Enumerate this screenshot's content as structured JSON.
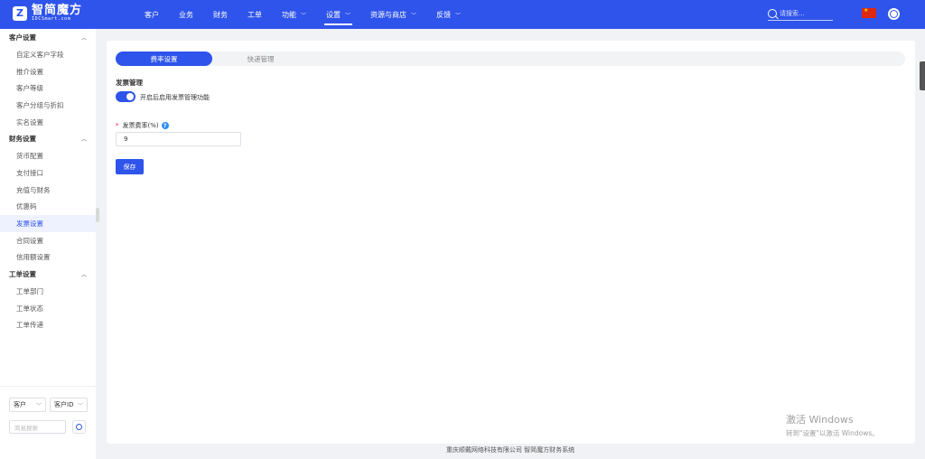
{
  "brand": {
    "name": "智简魔方",
    "sub": "IDCSmart.com"
  },
  "nav": [
    {
      "label": "客户",
      "dropdown": false,
      "active": false
    },
    {
      "label": "业务",
      "dropdown": false,
      "active": false
    },
    {
      "label": "财务",
      "dropdown": false,
      "active": false
    },
    {
      "label": "工单",
      "dropdown": false,
      "active": false
    },
    {
      "label": "功能",
      "dropdown": true,
      "active": false
    },
    {
      "label": "设置",
      "dropdown": true,
      "active": true
    },
    {
      "label": "资源与商店",
      "dropdown": true,
      "active": false
    },
    {
      "label": "反馈",
      "dropdown": true,
      "active": false
    }
  ],
  "search": {
    "placeholder": "请搜索..."
  },
  "sidebar": {
    "groups": [
      {
        "title": "客户设置",
        "items": [
          "自定义客户字段",
          "推介设置",
          "客户等级",
          "客户分组与折扣",
          "实名设置"
        ]
      },
      {
        "title": "财务设置",
        "items": [
          "货币配置",
          "支付接口",
          "充值与财务",
          "优惠码",
          "发票设置",
          "合同设置",
          "信用额设置"
        ]
      },
      {
        "title": "工单设置",
        "items": [
          "工单部门",
          "工单状态",
          "工单传递"
        ]
      }
    ],
    "active_item": "发票设置",
    "filter": {
      "type_value": "客户",
      "field_value": "客户ID",
      "search_placeholder": "简易搜索"
    }
  },
  "tabs": [
    {
      "label": "费率设置",
      "active": true
    },
    {
      "label": "快递管理",
      "active": false
    }
  ],
  "invoice": {
    "section_title": "发票管理",
    "switch_on": true,
    "switch_label": "开启后启用发票管理功能",
    "rate_label": "发票费率(%)",
    "rate_value": "9",
    "help_symbol": "?",
    "required_mark": "*",
    "save_label": "保存"
  },
  "watermark": {
    "title": "激活 Windows",
    "subtitle": "转到\"设置\"以激活 Windows。"
  },
  "footer": "重庆顺戴网络科技有限公司 智简魔方财务系统",
  "colors": {
    "primary": "#2f54eb",
    "background": "#f0f2f5"
  }
}
